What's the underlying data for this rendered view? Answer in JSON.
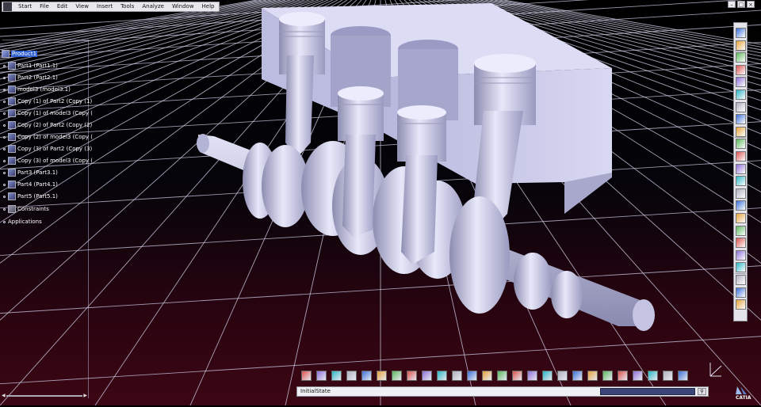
{
  "menu": [
    "Start",
    "File",
    "Edit",
    "View",
    "Insert",
    "Tools",
    "Analyze",
    "Window",
    "Help"
  ],
  "window_controls": [
    "–",
    "□",
    "×"
  ],
  "tree": {
    "root": "Product1",
    "items": [
      "Part1 (Part1.1)",
      "Part2 (Part2.1)",
      "model3 (model3.1)",
      "Copy (1) of Part2 (Copy (1)",
      "Copy (1) of model3 (Copy (",
      "Copy (2) of Part2 (Copy (2)",
      "Copy (2) of model3 (Copy (",
      "Copy (3) of Part2 (Copy (3)",
      "Copy (3) of model3 (Copy (",
      "Part3 (Part3.1)",
      "Part4 (Part4.1)",
      "Part5 (Part5.1)",
      "Constraints",
      "Applications"
    ]
  },
  "command": {
    "state_text": "InitialState",
    "input_value": ""
  },
  "brand": "CATIA",
  "colors": {
    "background_top": "#000000",
    "background_bottom": "#3c0614",
    "grid": "#d8d8f0",
    "model": "#c8c8e8",
    "selection": "#2f5fd0"
  },
  "icons": {
    "right_toolbar": [
      "lock-icon",
      "select-arrow-icon",
      "snap-icon",
      "new-component-icon",
      "existing-component-icon",
      "replace-icon",
      "graph-tree-icon",
      "generate-numbering-icon",
      "manipulation-icon",
      "explode-icon",
      "coincidence-constraint-icon",
      "contact-constraint-icon",
      "offset-constraint-icon",
      "angle-constraint-icon",
      "fix-constraint-icon",
      "clash-icon",
      "sectioning-icon",
      "distance-icon",
      "bill-of-material-icon",
      "catalog-icon",
      "scenes-icon",
      "annotation-icon",
      "weld-icon"
    ],
    "bottom_toolbar": [
      "fly-mode-icon",
      "fit-all-icon",
      "pan-icon",
      "rotate-icon",
      "zoom-in-icon",
      "zoom-out-icon",
      "normal-view-icon",
      "multi-view-icon",
      "iso-view-icon",
      "shading-icon",
      "hide-show-icon",
      "swap-visible-icon",
      "update-icon",
      "publish-icon",
      "measure-between-icon",
      "measure-item-icon",
      "measure-inertia-icon",
      "compass-icon",
      "render-icon",
      "catalog-browser-icon",
      "search-icon",
      "material-icon",
      "light-icon",
      "web-icon",
      "macro-icon",
      "view-mode-icon"
    ]
  }
}
